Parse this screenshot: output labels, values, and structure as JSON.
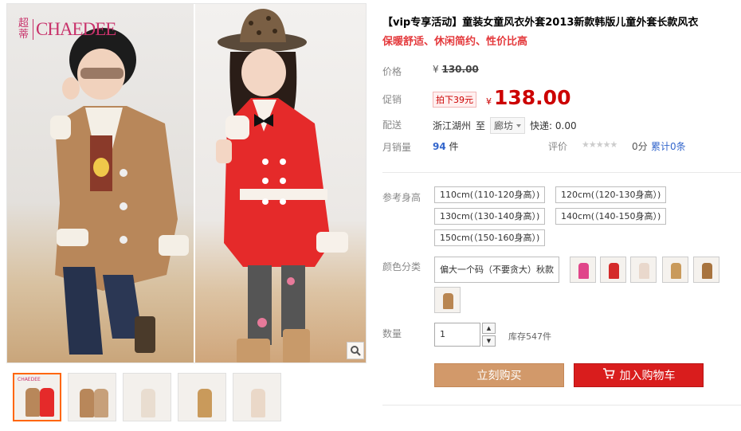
{
  "gallery": {
    "brand_cn": "超蒂",
    "brand_en": "CHAEDEE",
    "thumbnails": [
      "thumb-1",
      "thumb-2",
      "thumb-3",
      "thumb-4",
      "thumb-5"
    ],
    "zoom_icon": "magnifier-icon"
  },
  "product": {
    "title": "【vip专享活动】童装女童风衣外套2013新款韩版儿童外套长款风衣",
    "subtitle": "保暖舒适、休闲简约、性价比高"
  },
  "price": {
    "label": "价格",
    "currency": "¥",
    "original": "130.00",
    "promo_label": "促销",
    "promo_tag": "拍下39元",
    "promo_currency": "¥",
    "promo_value": "138.00"
  },
  "shipping": {
    "label": "配送",
    "from": "浙江湖州",
    "to_word": "至",
    "to_city": "廊坊",
    "express": "快递: 0.00"
  },
  "sales": {
    "label": "月销量",
    "count": "94",
    "unit": "件",
    "rating_label": "评价",
    "stars": "★★★★★",
    "score": "0分",
    "reviews": "累计0条"
  },
  "sizes": {
    "label": "参考身高",
    "options": [
      "110cm(（110-120身高）)",
      "120cm(（120-130身高）)",
      "130cm(（130-140身高）)",
      "140cm(（140-150身高）)",
      "150cm(（150-160身高）)"
    ]
  },
  "colors": {
    "label": "颜色分类",
    "text_option": "偏大一个码（不要贪大）秋款",
    "swatch_colors": [
      "#e0468a",
      "#d42a2a",
      "#e9d8cc",
      "#c99a5b",
      "#a8743f",
      "#b98652"
    ]
  },
  "quantity": {
    "label": "数量",
    "value": "1",
    "up": "▲",
    "down": "▼",
    "stock": "库存547件"
  },
  "actions": {
    "buy_now": "立刻购买",
    "add_to_cart": "加入购物车"
  },
  "colors_theme": {
    "accent_red": "#c00000",
    "buy_button": "#d2996a",
    "cart_button": "#d91d1d",
    "link_blue": "#3366cc"
  }
}
